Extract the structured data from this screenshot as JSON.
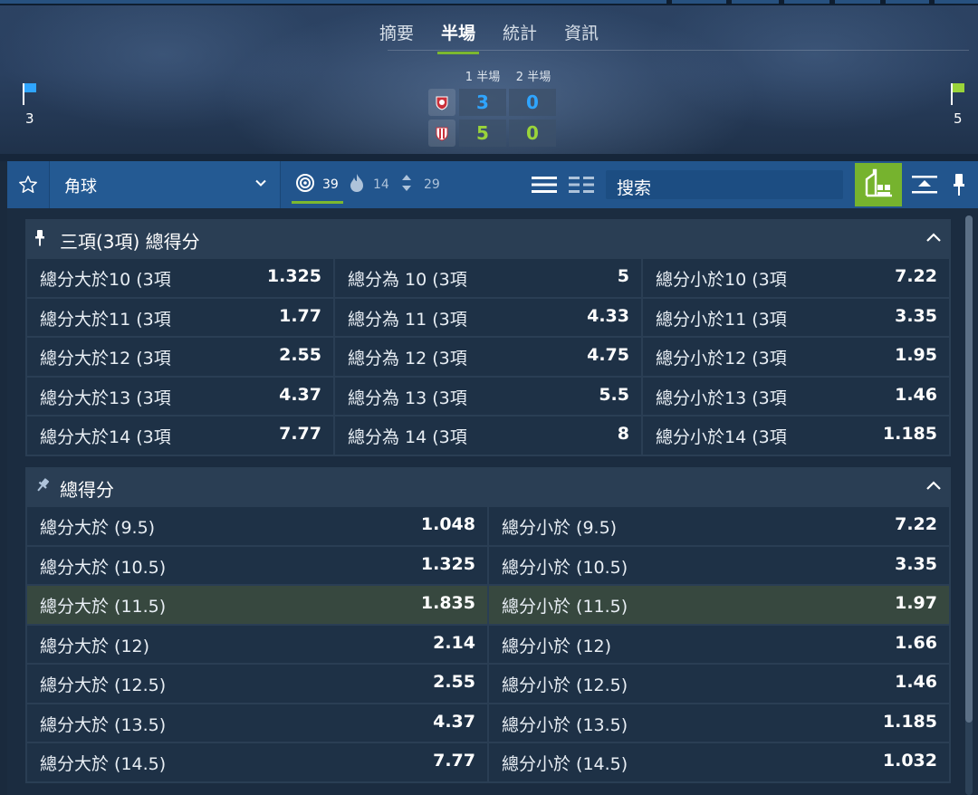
{
  "hero": {
    "tabs": [
      {
        "label": "摘要",
        "active": false
      },
      {
        "label": "半場",
        "active": true
      },
      {
        "label": "統計",
        "active": false
      },
      {
        "label": "資訊",
        "active": false
      }
    ],
    "half_labels": [
      "1 半場",
      "2 半場"
    ],
    "home": {
      "corners": "3",
      "flag_color": "#2fa5ff",
      "h1": "3",
      "h2": "0"
    },
    "away": {
      "corners": "5",
      "flag_color": "#9ad43a",
      "h1": "5",
      "h2": "0"
    }
  },
  "toolbar": {
    "market_select": "角球",
    "stats": [
      {
        "icon": "target-icon",
        "value": "39"
      },
      {
        "icon": "fire-icon",
        "value": "14"
      },
      {
        "icon": "up-down-icon",
        "value": "29"
      }
    ],
    "search_placeholder": "搜索",
    "colors": {
      "bar": "#22558d",
      "accent": "#76b32e"
    }
  },
  "sections": [
    {
      "title": "三項(3項) 總得分",
      "columns": 3,
      "rows": [
        [
          {
            "label": "總分大於10 (3項",
            "odd": "1.325"
          },
          {
            "label": "總分為 10 (3項",
            "odd": "5"
          },
          {
            "label": "總分小於10 (3項",
            "odd": "7.22"
          }
        ],
        [
          {
            "label": "總分大於11 (3項",
            "odd": "1.77"
          },
          {
            "label": "總分為 11 (3項",
            "odd": "4.33"
          },
          {
            "label": "總分小於11 (3項",
            "odd": "3.35"
          }
        ],
        [
          {
            "label": "總分大於12 (3項",
            "odd": "2.55"
          },
          {
            "label": "總分為 12 (3項",
            "odd": "4.75"
          },
          {
            "label": "總分小於12 (3項",
            "odd": "1.95"
          }
        ],
        [
          {
            "label": "總分大於13 (3項",
            "odd": "4.37"
          },
          {
            "label": "總分為 13 (3項",
            "odd": "5.5"
          },
          {
            "label": "總分小於13 (3項",
            "odd": "1.46"
          }
        ],
        [
          {
            "label": "總分大於14 (3項",
            "odd": "7.77"
          },
          {
            "label": "總分為 14 (3項",
            "odd": "8"
          },
          {
            "label": "總分小於14 (3項",
            "odd": "1.185"
          }
        ]
      ]
    },
    {
      "title": "總得分",
      "columns": 2,
      "rows": [
        [
          {
            "label": "總分大於 (9.5)",
            "odd": "1.048"
          },
          {
            "label": "總分小於 (9.5)",
            "odd": "7.22"
          }
        ],
        [
          {
            "label": "總分大於 (10.5)",
            "odd": "1.325"
          },
          {
            "label": "總分小於 (10.5)",
            "odd": "3.35"
          }
        ],
        [
          {
            "label": "總分大於 (11.5)",
            "odd": "1.835",
            "highlight": true
          },
          {
            "label": "總分小於 (11.5)",
            "odd": "1.97",
            "highlight": true
          }
        ],
        [
          {
            "label": "總分大於 (12)",
            "odd": "2.14"
          },
          {
            "label": "總分小於 (12)",
            "odd": "1.66"
          }
        ],
        [
          {
            "label": "總分大於 (12.5)",
            "odd": "2.55"
          },
          {
            "label": "總分小於 (12.5)",
            "odd": "1.46"
          }
        ],
        [
          {
            "label": "總分大於 (13.5)",
            "odd": "4.37"
          },
          {
            "label": "總分小於 (13.5)",
            "odd": "1.185"
          }
        ],
        [
          {
            "label": "總分大於 (14.5)",
            "odd": "7.77"
          },
          {
            "label": "總分小於 (14.5)",
            "odd": "1.032"
          }
        ]
      ]
    }
  ]
}
